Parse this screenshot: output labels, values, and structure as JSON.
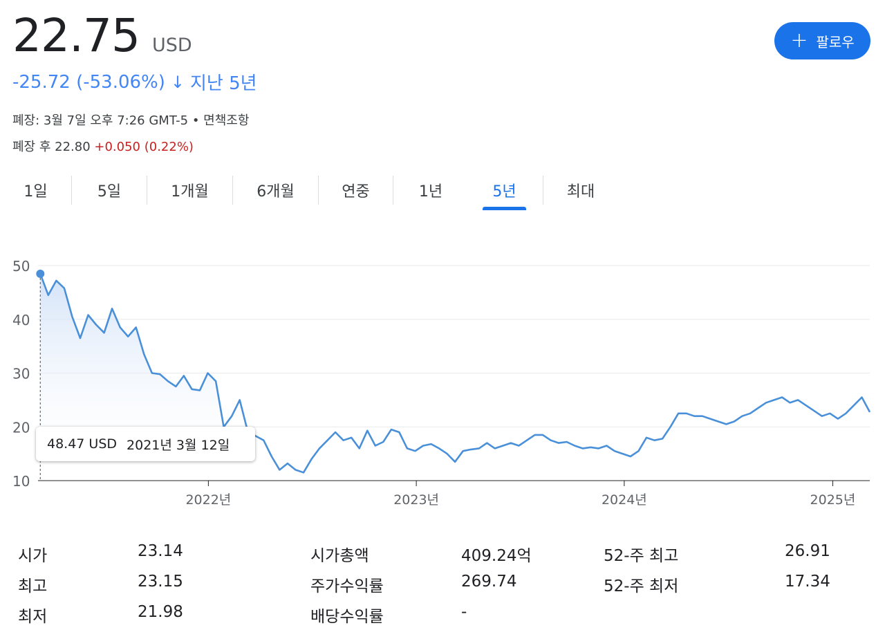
{
  "quote": {
    "price": "22.75",
    "currency": "USD",
    "change": "-25.72 (-53.06%)",
    "change_arrow": "↓",
    "period": "지난 5년",
    "close_info": "폐장: 3월 7일 오후 7:26 GMT-5 • 면책조항",
    "after_hours_label": "폐장 후 22.80",
    "after_hours_change": "+0.050 (0.22%)"
  },
  "follow_button": {
    "icon": "plus-icon",
    "label": "팔로우"
  },
  "colors": {
    "accent": "#1a73e8",
    "line": "#4a90d9",
    "negative": "#4285f4",
    "positive": "#c5221f"
  },
  "tabs": [
    {
      "label": "1일",
      "active": false
    },
    {
      "label": "5일",
      "active": false
    },
    {
      "label": "1개월",
      "active": false
    },
    {
      "label": "6개월",
      "active": false
    },
    {
      "label": "연중",
      "active": false
    },
    {
      "label": "1년",
      "active": false
    },
    {
      "label": "5년",
      "active": true
    },
    {
      "label": "최대",
      "active": false
    }
  ],
  "tooltip": {
    "value": "48.47 USD",
    "date": "2021년 3월 12일"
  },
  "chart_data": {
    "type": "area",
    "y_ticks": [
      "50",
      "40",
      "30",
      "20",
      "10"
    ],
    "ylim": [
      10,
      50
    ],
    "x_ticks": [
      "2022년",
      "2023년",
      "2024년",
      "2025년"
    ],
    "xlim": [
      "2021-03-08",
      "2025-03-07"
    ],
    "series": [
      {
        "x": [
          "2021-03-12",
          "2021-03-26",
          "2021-04-09",
          "2021-04-23",
          "2021-05-07",
          "2021-05-21",
          "2021-06-04",
          "2021-06-18",
          "2021-07-02",
          "2021-07-16",
          "2021-07-30",
          "2021-08-13",
          "2021-08-27",
          "2021-09-10",
          "2021-09-24",
          "2021-10-08",
          "2021-10-22",
          "2021-11-05",
          "2021-11-19",
          "2021-12-03",
          "2021-12-17",
          "2021-12-31",
          "2022-01-14",
          "2022-01-28",
          "2022-02-11",
          "2022-02-25",
          "2022-03-11",
          "2022-03-25",
          "2022-04-08",
          "2022-04-22",
          "2022-05-06",
          "2022-05-20",
          "2022-06-03",
          "2022-06-17",
          "2022-07-01",
          "2022-07-15",
          "2022-07-29",
          "2022-08-12",
          "2022-08-26",
          "2022-09-09",
          "2022-09-23",
          "2022-10-07",
          "2022-10-21",
          "2022-11-04",
          "2022-11-18",
          "2022-12-02",
          "2022-12-16",
          "2022-12-30",
          "2023-01-13",
          "2023-01-27",
          "2023-02-10",
          "2023-02-24",
          "2023-03-10",
          "2023-03-24",
          "2023-04-07",
          "2023-04-21",
          "2023-05-05",
          "2023-05-19",
          "2023-06-02",
          "2023-06-16",
          "2023-06-30",
          "2023-07-14",
          "2023-07-28",
          "2023-08-11",
          "2023-08-25",
          "2023-09-08",
          "2023-09-22",
          "2023-10-06",
          "2023-10-20",
          "2023-11-03",
          "2023-11-17",
          "2023-12-01",
          "2023-12-15",
          "2023-12-29",
          "2024-01-12",
          "2024-01-26",
          "2024-02-09",
          "2024-02-23",
          "2024-03-08",
          "2024-03-22",
          "2024-04-05",
          "2024-04-19",
          "2024-05-03",
          "2024-05-17",
          "2024-05-31",
          "2024-06-14",
          "2024-06-28",
          "2024-07-12",
          "2024-07-26",
          "2024-08-09",
          "2024-08-23",
          "2024-09-06",
          "2024-09-20",
          "2024-10-04",
          "2024-10-18",
          "2024-11-01",
          "2024-11-15",
          "2024-11-29",
          "2024-12-13",
          "2024-12-27",
          "2025-01-10",
          "2025-01-24",
          "2025-02-07",
          "2025-02-21",
          "2025-03-07"
        ],
        "y": [
          48.47,
          44.5,
          47.2,
          45.8,
          40.5,
          36.5,
          40.8,
          39.0,
          37.5,
          42.0,
          38.5,
          36.8,
          38.5,
          33.5,
          30.0,
          29.8,
          28.5,
          27.5,
          29.5,
          27.0,
          26.8,
          30.0,
          28.5,
          20.0,
          22.0,
          25.0,
          19.2,
          18.3,
          17.5,
          14.5,
          12.0,
          13.2,
          12.0,
          11.5,
          14.0,
          16.0,
          17.5,
          19.0,
          17.5,
          18.0,
          16.0,
          19.3,
          16.5,
          17.2,
          19.5,
          19.0,
          16.0,
          15.5,
          16.5,
          16.8,
          16.0,
          15.0,
          13.5,
          15.5,
          15.8,
          16.0,
          17.0,
          16.0,
          16.5,
          17.0,
          16.5,
          17.5,
          18.5,
          18.5,
          17.5,
          17.0,
          17.2,
          16.5,
          16.0,
          16.2,
          16.0,
          16.5,
          15.5,
          15.0,
          14.5,
          15.5,
          18.0,
          17.5,
          17.8,
          20.0,
          22.5,
          22.5,
          22.0,
          22.0,
          21.5,
          21.0,
          20.5,
          21.0,
          22.0,
          22.5,
          23.5,
          24.5,
          25.0,
          25.5,
          24.5,
          25.0,
          24.0,
          23.0,
          22.0,
          22.5,
          21.5,
          22.5,
          24.0,
          25.5,
          22.75
        ]
      }
    ]
  },
  "stats": [
    {
      "label": "시가",
      "value": "23.14"
    },
    {
      "label": "최고",
      "value": "23.15"
    },
    {
      "label": "최저",
      "value": "21.98"
    },
    {
      "label": "시가총액",
      "value": "409.24억"
    },
    {
      "label": "주가수익률",
      "value": "269.74"
    },
    {
      "label": "배당수익률",
      "value": "-"
    },
    {
      "label": "52-주 최고",
      "value": "26.91"
    },
    {
      "label": "52-주 최저",
      "value": "17.34"
    }
  ]
}
